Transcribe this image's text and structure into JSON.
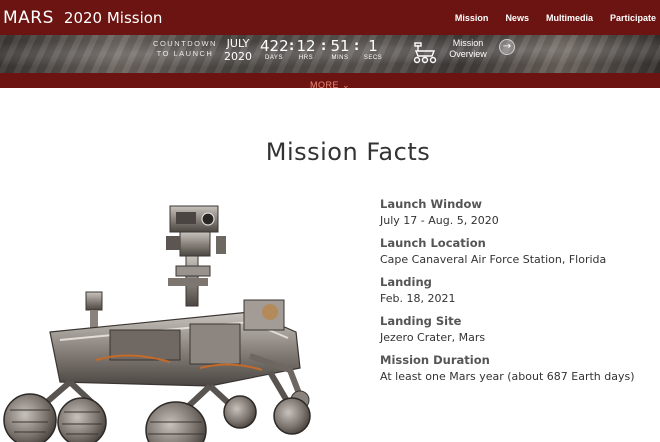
{
  "header": {
    "logo_mars": "MARS",
    "logo_title": "2020 Mission",
    "nav": [
      "Mission",
      "News",
      "Multimedia",
      "Participate"
    ]
  },
  "countdown": {
    "label_line1": "COUNTDOWN",
    "label_line2": "TO LAUNCH",
    "month": "JULY",
    "year": "2020",
    "days": "422",
    "days_label": "DAYS",
    "hrs": "12",
    "hrs_label": "HRS",
    "mins": "51",
    "mins_label": "MINS",
    "secs": "1",
    "secs_label": "SECS",
    "overview_line1": "Mission",
    "overview_line2": "Overview"
  },
  "more": {
    "label": "MORE ⌄"
  },
  "main": {
    "title": "Mission Facts",
    "facts": [
      {
        "label": "Launch Window",
        "value": "July 17 - Aug. 5, 2020"
      },
      {
        "label": "Launch Location",
        "value": "Cape Canaveral Air Force Station, Florida"
      },
      {
        "label": "Landing",
        "value": "Feb. 18, 2021"
      },
      {
        "label": "Landing Site",
        "value": "Jezero Crater, Mars"
      },
      {
        "label": "Mission Duration",
        "value": "At least one Mars year (about 687 Earth days)"
      }
    ]
  },
  "colors": {
    "header_bg": "#6b1411",
    "more_text": "#f08a7a"
  },
  "icons": {
    "rover": "rover-icon",
    "arrow": "arrow-right-icon",
    "chevron": "chevron-down-icon"
  }
}
